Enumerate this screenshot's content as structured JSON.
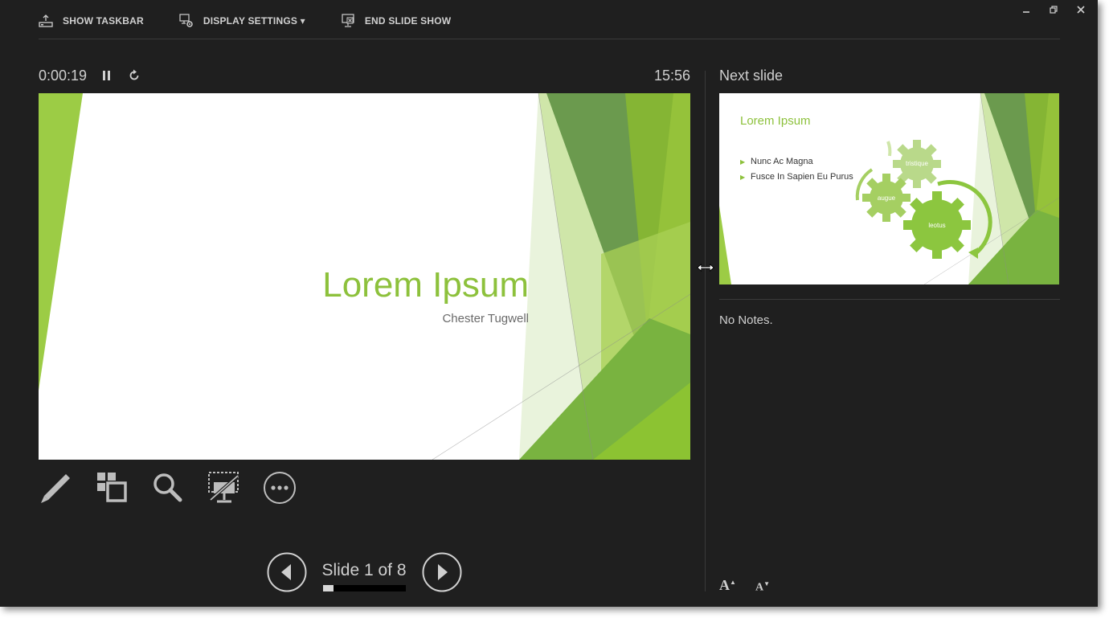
{
  "toolbar": {
    "show_taskbar": "SHOW TASKBAR",
    "display_settings": "DISPLAY SETTINGS ▾",
    "end_slide_show": "END SLIDE SHOW"
  },
  "window_controls": [
    "minimize-icon",
    "restore-icon",
    "close-icon"
  ],
  "timer": {
    "elapsed": "0:00:19",
    "clock": "15:56"
  },
  "current_slide": {
    "title": "Lorem Ipsum",
    "subtitle": "Chester Tugwell"
  },
  "tools": [
    "pen-icon",
    "see-all-slides-icon",
    "zoom-icon",
    "black-screen-icon",
    "more-options-icon"
  ],
  "navigation": {
    "counter": "Slide 1 of 8",
    "current": 1,
    "total": 8
  },
  "next_slide": {
    "label": "Next slide",
    "title": "Lorem Ipsum",
    "bullets": [
      "Nunc Ac Magna",
      "Fusce In Sapien Eu Purus"
    ],
    "gears": [
      "tristique",
      "augue",
      "leotus"
    ]
  },
  "notes": {
    "text": "No Notes."
  },
  "font_controls": {
    "increase": "A",
    "decrease": "A"
  },
  "colors": {
    "background": "#1f1f1f",
    "accent_green": "#8dc13c",
    "text": "#cfcfcf"
  }
}
